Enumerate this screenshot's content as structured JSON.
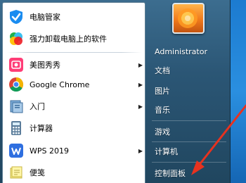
{
  "programs": [
    {
      "label": "电脑管家",
      "icon": "tencent-pc-manager-icon",
      "arrow": false
    },
    {
      "label": "强力卸载电脑上的软件",
      "icon": "uninstall-icon",
      "arrow": false
    },
    {
      "label": "美图秀秀",
      "icon": "meitu-icon",
      "arrow": true
    },
    {
      "label": "Google Chrome",
      "icon": "chrome-icon",
      "arrow": true
    },
    {
      "label": "入门",
      "icon": "getting-started-icon",
      "arrow": true
    },
    {
      "label": "计算器",
      "icon": "calculator-icon",
      "arrow": false
    },
    {
      "label": "WPS 2019",
      "icon": "wps-icon",
      "arrow": true
    },
    {
      "label": "便笺",
      "icon": "sticky-notes-icon",
      "arrow": false
    }
  ],
  "arrow_glyph": "▶",
  "right_pane": {
    "username": "Administrator",
    "documents": "文档",
    "pictures": "图片",
    "music": "音乐",
    "games": "游戏",
    "computer": "计算机",
    "control_panel": "控制面板"
  },
  "colors": {
    "annotation_arrow": "#e8321f",
    "menu_frame": "#2b5675",
    "desktop": "#1d6fb5"
  }
}
